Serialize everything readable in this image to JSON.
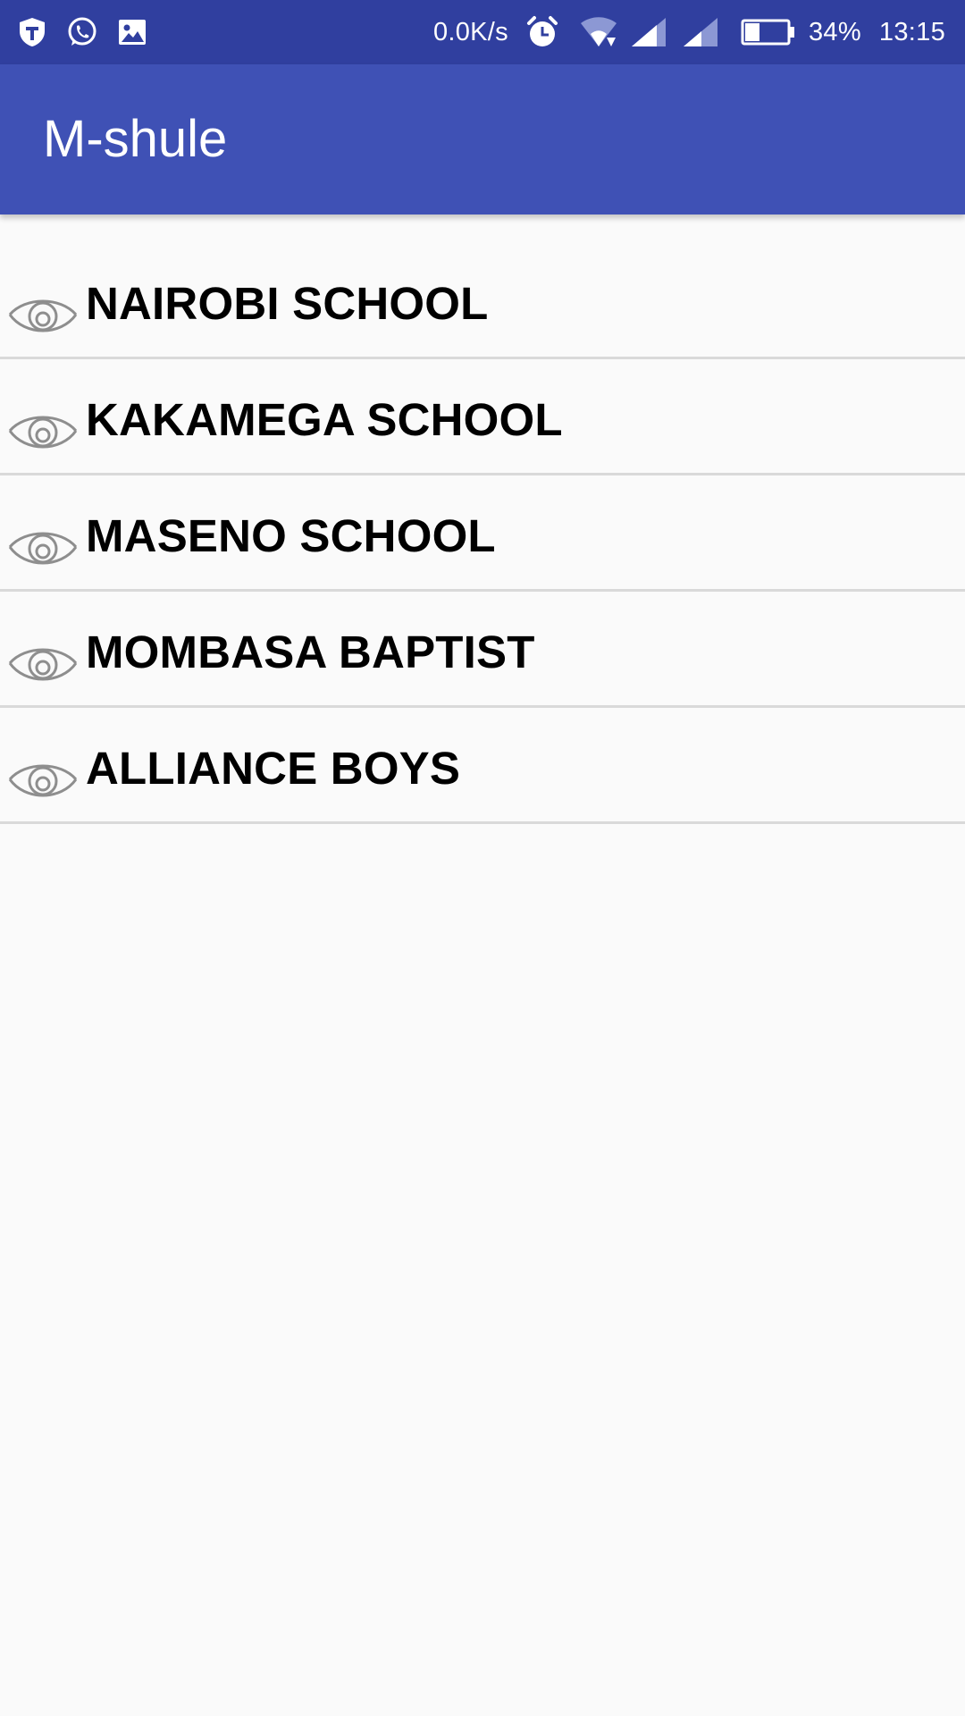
{
  "status_bar": {
    "left_icons": [
      "shield-icon",
      "whatsapp-icon",
      "gallery-icon"
    ],
    "net_speed": "0.0K/s",
    "right_icons": [
      "alarm-icon",
      "wifi-icon",
      "signal-sim1-icon",
      "signal-sim2-icon",
      "battery-icon"
    ],
    "battery_level": 0.34,
    "battery_percent": "34%",
    "time": "13:15"
  },
  "app_bar": {
    "title": "M-shule"
  },
  "schools": [
    {
      "name": "NAIROBI SCHOOL",
      "icon": "eye-icon"
    },
    {
      "name": "KAKAMEGA SCHOOL",
      "icon": "eye-icon"
    },
    {
      "name": "MASENO SCHOOL",
      "icon": "eye-icon"
    },
    {
      "name": "MOMBASA BAPTIST",
      "icon": "eye-icon"
    },
    {
      "name": "ALLIANCE BOYS",
      "icon": "eye-icon"
    }
  ],
  "colors": {
    "status_bar": "#303f9f",
    "app_bar": "#3f51b5",
    "background": "#fafafa",
    "divider": "#d9d9d9",
    "icon_gray": "#8e8e8e"
  }
}
